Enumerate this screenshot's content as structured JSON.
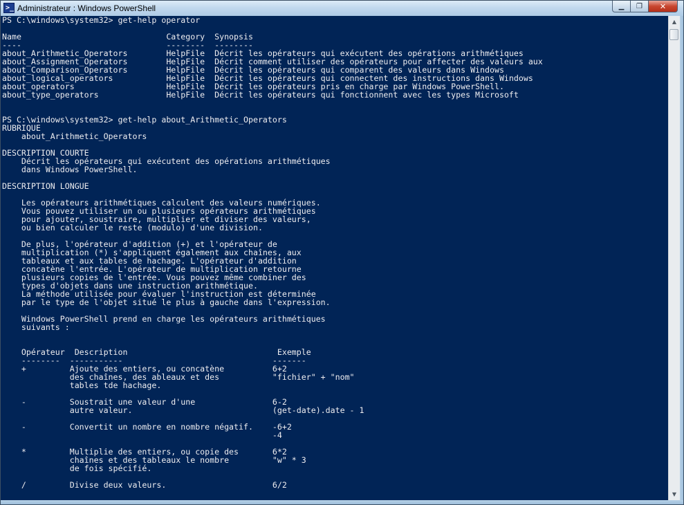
{
  "window": {
    "title": "Administrateur : Windows PowerShell",
    "icon": "powershell-icon",
    "icon_glyph": ">_",
    "minimize_glyph": "▁",
    "maximize_glyph": "❐",
    "close_glyph": "✕"
  },
  "scrollbar": {
    "up_glyph": "▲",
    "down_glyph": "▼"
  },
  "colors": {
    "console_background": "#012456",
    "console_text": "#EEEDF0"
  },
  "console": {
    "lines": [
      "PS C:\\windows\\system32> get-help operator",
      "",
      "Name                              Category  Synopsis",
      "----                              --------  --------",
      "about_Arithmetic_Operators        HelpFile  Décrit les opérateurs qui exécutent des opérations arithmétiques",
      "about_Assignment_Operators        HelpFile  Décrit comment utiliser des opérateurs pour affecter des valeurs aux",
      "about_Comparison_Operators        HelpFile  Décrit les opérateurs qui comparent des valeurs dans Windows",
      "about_logical_operators           HelpFile  Décrit les opérateurs qui connectent des instructions dans Windows",
      "about_operators                   HelpFile  Décrit les opérateurs pris en charge par Windows PowerShell.",
      "about_type_operators              HelpFile  Décrit les opérateurs qui fonctionnent avec les types Microsoft",
      "",
      "",
      "PS C:\\windows\\system32> get-help about_Arithmetic_Operators",
      "RUBRIQUE",
      "    about_Arithmetic_Operators",
      "",
      "DESCRIPTION COURTE",
      "    Décrit les opérateurs qui exécutent des opérations arithmétiques",
      "    dans Windows PowerShell.",
      "",
      "DESCRIPTION LONGUE",
      "",
      "    Les opérateurs arithmétiques calculent des valeurs numériques.",
      "    Vous pouvez utiliser un ou plusieurs opérateurs arithmétiques",
      "    pour ajouter, soustraire, multiplier et diviser des valeurs,",
      "    ou bien calculer le reste (modulo) d'une division.",
      "",
      "    De plus, l'opérateur d'addition (+) et l'opérateur de",
      "    multiplication (*) s'appliquent également aux chaînes, aux",
      "    tableaux et aux tables de hachage. L'opérateur d'addition",
      "    concatène l'entrée. L'opérateur de multiplication retourne",
      "    plusieurs copies de l'entrée. Vous pouvez même combiner des",
      "    types d'objets dans une instruction arithmétique.",
      "    La méthode utilisée pour évaluer l'instruction est déterminée",
      "    par le type de l'objet situé le plus à gauche dans l'expression.",
      "",
      "    Windows PowerShell prend en charge les opérateurs arithmétiques",
      "    suivants :",
      "",
      "",
      "    Opérateur  Description                               Exemple",
      "    --------  -----------                               -------",
      "    +         Ajoute des entiers, ou concatène          6+2",
      "              des chaînes, des ableaux et des           \"fichier\" + \"nom\"",
      "              tables tde hachage.",
      "",
      "    -         Soustrait une valeur d'une                6-2",
      "              autre valeur.                             (get-date).date - 1",
      "",
      "    -         Convertit un nombre en nombre négatif.    -6+2",
      "                                                        -4",
      "",
      "    *         Multiplie des entiers, ou copie des       6*2",
      "              chaînes et des tableaux le nombre         \"w\" * 3",
      "              de fois spécifié.",
      "",
      "    /         Divise deux valeurs.                      6/2",
      ""
    ]
  }
}
